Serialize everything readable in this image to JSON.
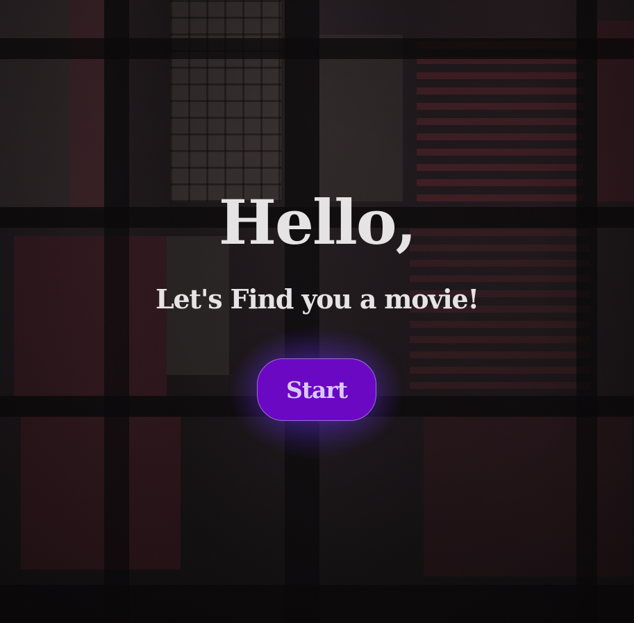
{
  "hero": {
    "title": "Hello,",
    "subtitle": "Let's Find you a movie!"
  },
  "actions": {
    "start_label": "Start"
  },
  "colors": {
    "background": "#1a1719",
    "text": "#e6e3e4",
    "button_fill": "#6a08c4",
    "button_border": "#9b6fd6",
    "button_text": "#d9c8f4",
    "glow": "#6230dc"
  }
}
